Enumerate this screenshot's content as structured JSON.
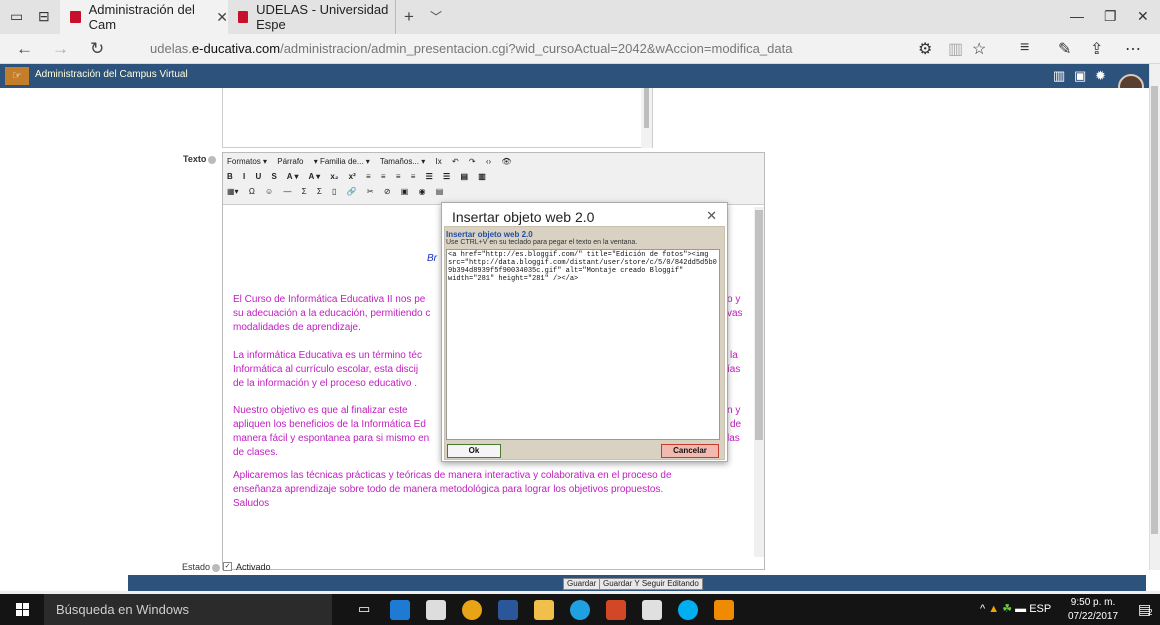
{
  "browser": {
    "tabs": [
      {
        "label": "Administración del Cam"
      },
      {
        "label": "UDELAS - Universidad Espe"
      }
    ],
    "url_domain": "udelas.",
    "url_bold": "e-ducativa.com",
    "url_path": "/administracion/admin_presentacion.cgi?wid_cursoActual=2042&wAccion=modifica_data"
  },
  "app": {
    "title": "Administración del Campus Virtual"
  },
  "form": {
    "texto_label": "Texto",
    "estado_label": "Estado",
    "activado_label": "Activado",
    "toolbar": {
      "row1": [
        "Formatos ▾",
        "Párrafo",
        "▾ Familia de... ▾",
        "Tamaños... ▾",
        "Ix",
        "↶",
        "↷",
        "‹›",
        "👁"
      ],
      "row2": [
        "B",
        "I",
        "U",
        "S",
        "A ▾",
        "A ▾",
        "x₂",
        "x²",
        "≡",
        "≡",
        "≡",
        "≡",
        "☰",
        "☰",
        "▤",
        "▥"
      ],
      "row3": [
        "▦▾",
        "Ω",
        "☺",
        "—",
        "Σ",
        "Σ",
        "▯",
        "🔗",
        "✂",
        "⊘",
        "▣",
        "◉",
        "▤"
      ]
    },
    "paragraphs": [
      "El Curso de Informática Educativa II nos pe",
      "su adecuación a la educación, permitiendo c",
      "modalidades de aprendizaje.",
      "La informática Educativa es un término téc",
      "Informática al currículo escolar, esta discij",
      "de la información y el proceso educativo .",
      "Nuestro objetivo es que al finalizar este",
      "apliquen los beneficios de la Informática Ed",
      "manera fácil y espontanea para si mismo en",
      "de clases.",
      "Aplicaremos las técnicas prácticas y teóricas de manera interactiva y colaborativa en el proceso de",
      "enseñanza aprendizaje sobre todo de manera metodológica para lograr los objetivos propuestos.",
      "Saludos"
    ],
    "right_fragments": [
      "o y",
      "vas",
      "la",
      "ías",
      "n y",
      "de",
      "las"
    ],
    "br_fragment": "Br",
    "save_button": "Guardar",
    "save_continue_button": "Guardar Y Seguir Editando"
  },
  "modal": {
    "title": "Insertar objeto web 2.0",
    "subtitle": "Insertar objeto web 2.0",
    "hint": "Use CTRL+V en su teclado para pegar el texto en la ventana.",
    "code": "<a href=\"http://es.bloggif.com/\" title=\"Edición de fotos\"><img src=\"http://data.bloggif.com/distant/user/store/c/5/0/842dd5d5b09b394d8939f5f90034035c.gif\" alt=\"Montaje creado Bloggif\" width=\"281\" height=\"281\" /></a>",
    "ok_label": "Ok",
    "cancel_label": "Cancelar"
  },
  "taskbar": {
    "search_placeholder": "Búsqueda en Windows",
    "lang": "ESP",
    "time": "9:50 p. m.",
    "date": "07/22/2017",
    "notif_count": "2"
  }
}
